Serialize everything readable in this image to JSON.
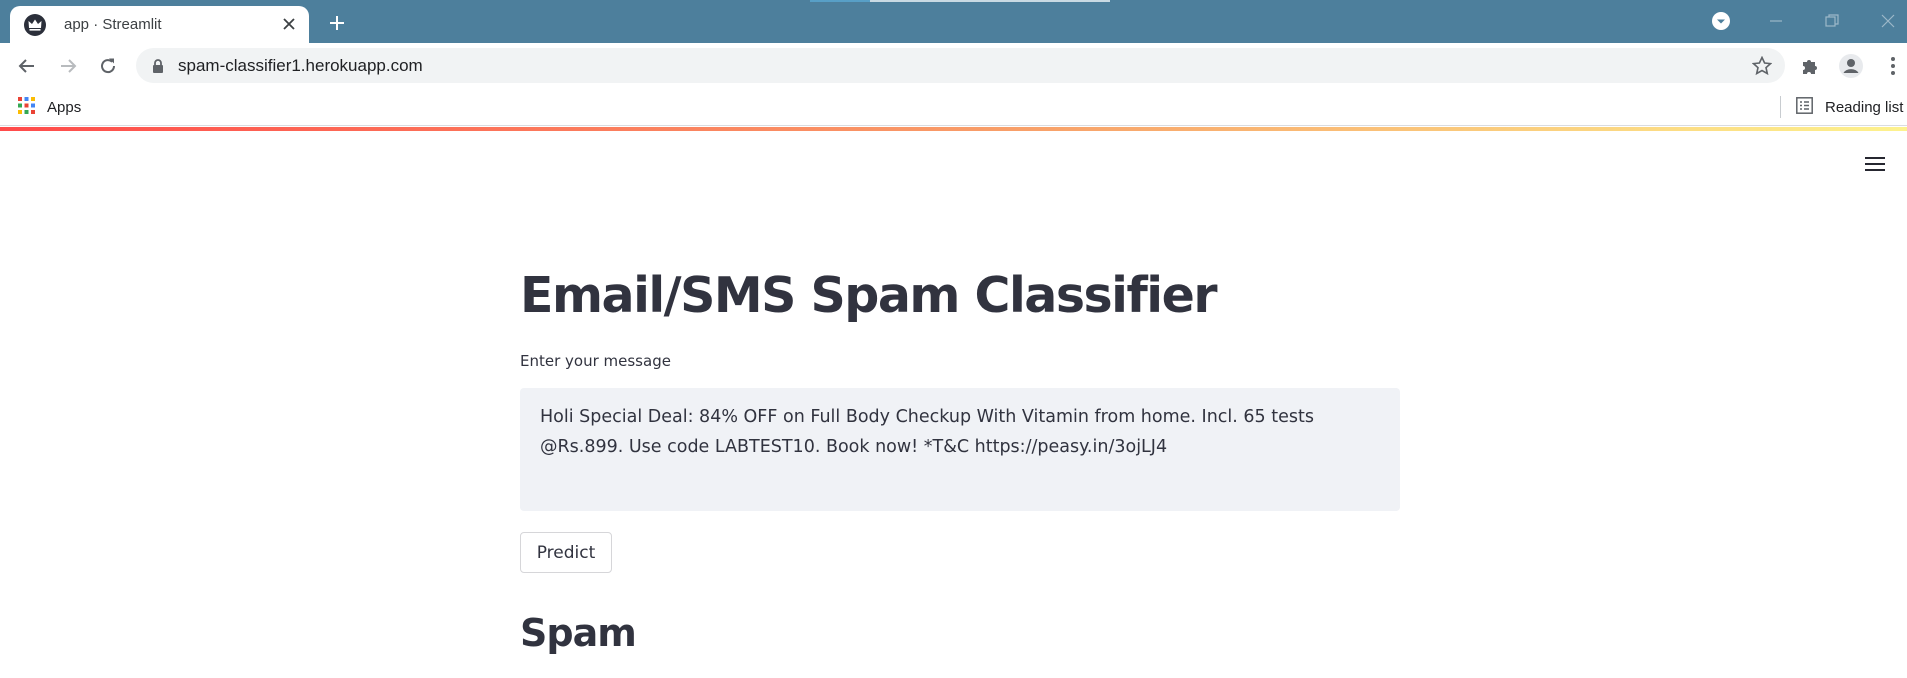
{
  "browser": {
    "tab": {
      "title": "app · Streamlit"
    },
    "address_bar": {
      "url": "spam-classifier1.herokuapp.com"
    },
    "bookmarks": {
      "apps_label": "Apps",
      "reading_list_label": "Reading list"
    },
    "colors": {
      "tabstrip": "#4d7f9c",
      "omnibox": "#f1f3f4"
    }
  },
  "app": {
    "title": "Email/SMS Spam Classifier",
    "input": {
      "label": "Enter your message",
      "value": "Holi Special Deal: 84% OFF on Full Body Checkup With Vitamin from home. Incl. 65 tests @Rs.899. Use code LABTEST10. Book now! *T&C https://peasy.in/3ojLJ4"
    },
    "predict_button": {
      "label": "Predict"
    },
    "result": {
      "text": "Spam"
    },
    "colors": {
      "text": "#31333f",
      "textarea_bg": "#f0f2f6",
      "accent": "#ff4b4b"
    }
  },
  "icons": [
    "streamlit-crown-icon",
    "close-icon",
    "plus-icon",
    "tab-search-icon",
    "minimize-icon",
    "restore-icon",
    "back-arrow-icon",
    "forward-arrow-icon",
    "reload-icon",
    "lock-icon",
    "star-icon",
    "puzzle-icon",
    "profile-icon",
    "kebab-menu-icon",
    "apps-grid-icon",
    "reading-list-icon",
    "hamburger-icon"
  ]
}
